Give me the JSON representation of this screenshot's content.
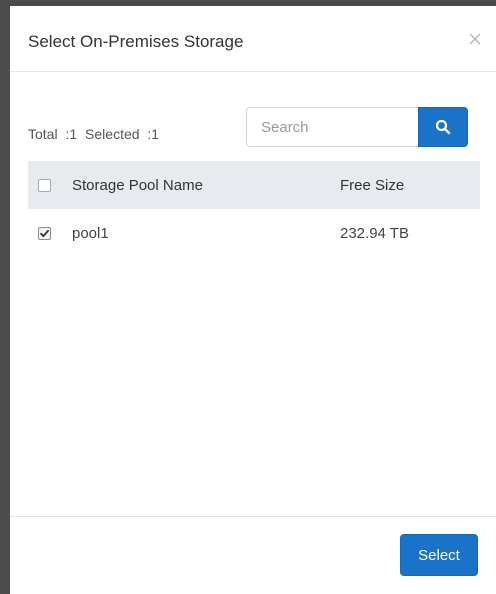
{
  "dialog": {
    "title": "Select On-Premises Storage"
  },
  "summary": {
    "total_label": "Total",
    "total_value": ":1",
    "selected_label": "Selected",
    "selected_value": ":1"
  },
  "search": {
    "placeholder": "Search",
    "value": "",
    "icon": "search-icon"
  },
  "table": {
    "columns": [
      "Storage Pool Name",
      "Free Size"
    ],
    "header_checked": false,
    "rows": [
      {
        "name": "pool1",
        "free_size": "232.94 TB",
        "checked": true
      }
    ]
  },
  "footer": {
    "select_label": "Select"
  },
  "colors": {
    "accent": "#1a73c8",
    "header_bg": "#e7eaee"
  }
}
